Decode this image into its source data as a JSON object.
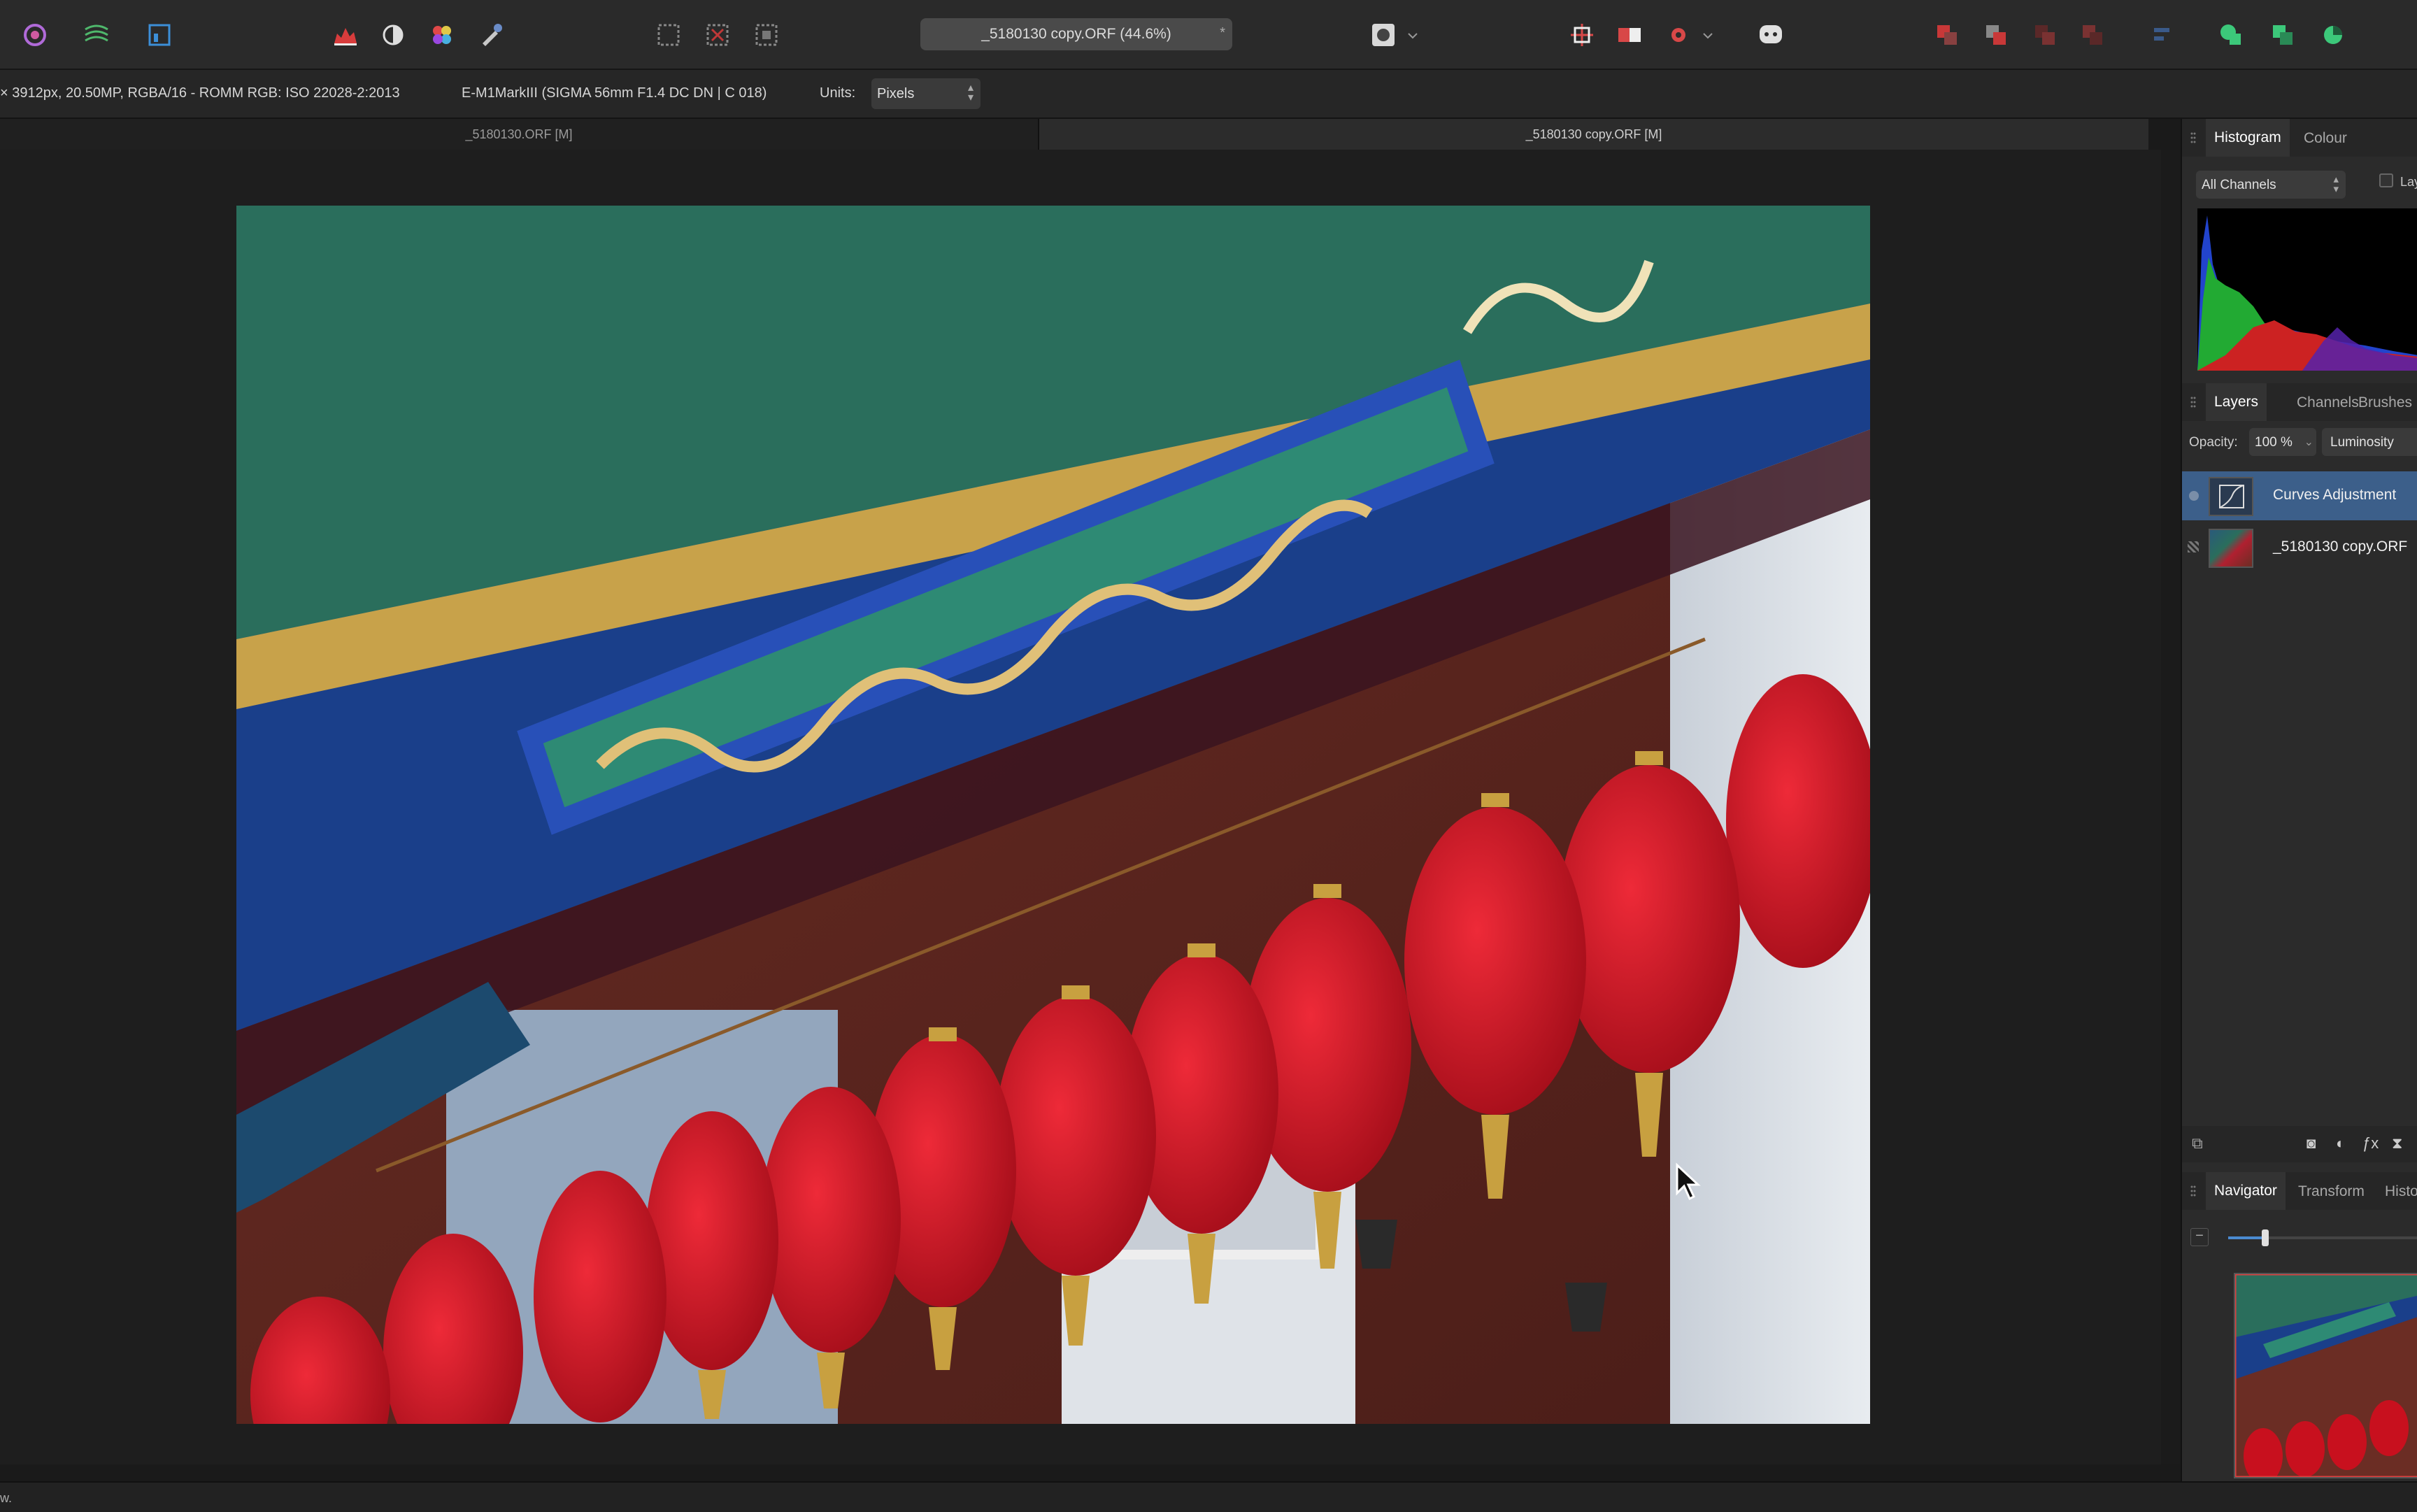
{
  "toolbar": {
    "document_title": "_5180130 copy.ORF (44.6%)",
    "modified_marker": "*",
    "tools": [
      "persona-photo-icon",
      "persona-liquify-icon",
      "persona-develop-icon",
      "histogram-tool-icon",
      "adjustment-icon",
      "colour-wheel-icon",
      "brush-icon",
      "marquee-rect-icon",
      "marquee-subtract-icon",
      "marquee-intersect-icon",
      "quickmask-icon",
      "snapping-icon",
      "order-icon",
      "assistant-icon",
      "arrange-icon",
      "boolean-add-icon",
      "boolean-subtract-icon",
      "boolean-intersect-icon"
    ]
  },
  "contextbar": {
    "info_text": "× 3912px, 20.50MP, RGBA/16 - ROMM RGB: ISO 22028-2:2013",
    "camera_text": "E-M1MarkIII (SIGMA 56mm F1.4 DC DN | C 018)",
    "units_label": "Units:",
    "units_value": "Pixels"
  },
  "doctabs": [
    {
      "label": "_5180130.ORF [M]",
      "active": false
    },
    {
      "label": "_5180130 copy.ORF [M]",
      "active": true
    }
  ],
  "panel": {
    "top_tabs": [
      "Histogram",
      "Colour"
    ],
    "channels_value": "All Channels",
    "layers_checkbox_label": "Lay",
    "layers_tabs": [
      "Layers",
      "Channels",
      "Brushes"
    ],
    "opacity_label": "Opacity:",
    "opacity_value": "100 %",
    "blend_mode": "Luminosity",
    "layers": [
      {
        "name": "Curves Adjustment",
        "selected": true,
        "icon": "curves-icon"
      },
      {
        "name": "_5180130 copy.ORF",
        "selected": false,
        "icon": "photo-thumbnail"
      }
    ],
    "bottom_tabs": [
      "Navigator",
      "Transform",
      "Histo"
    ]
  },
  "statusbar": {
    "text": "w."
  },
  "colors": {
    "accent": "#3a6ea5",
    "selected_layer": "#3c5f8a",
    "panel_bg": "#2b2b2b"
  }
}
